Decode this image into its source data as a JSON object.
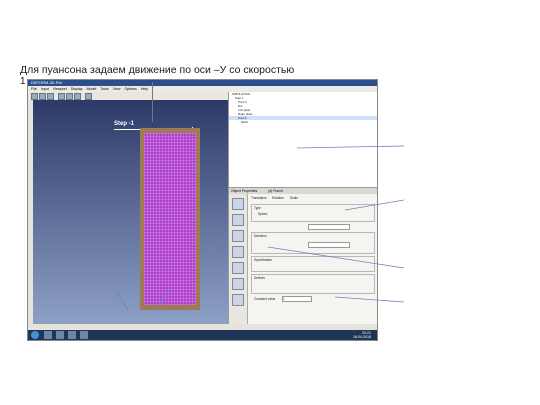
{
  "caption": {
    "line1": "Для пуансона задаем движение по оси –У  со скоростью",
    "line2": "1"
  },
  "app": {
    "title": "DEFORM-3D Pre",
    "menu": [
      "File",
      "Input",
      "Viewport",
      "Display",
      "Model",
      "Tools",
      "View",
      "Options",
      "Help"
    ]
  },
  "viewport": {
    "step_label": "Step -1"
  },
  "tree": {
    "items": [
      "SIMULATION",
      "Step 1",
      "Punch",
      "Die",
      "Left plate",
      "Right plate",
      "Punch",
      "Mesh"
    ]
  },
  "properties": {
    "header": "Object Properties",
    "object": "(4) Punch",
    "tabs": [
      "Translation",
      "Rotation",
      "Scale"
    ],
    "type_label": "Type",
    "speed_label": "Speed",
    "direction_label": "Direction",
    "specification_label": "Specification",
    "define_label": "Defines",
    "constant_value_label": "Constant value",
    "constant_value": "1"
  },
  "side_icons": [
    "General",
    "Geometry",
    "Mesh",
    "Movement",
    "Bdry. Cond.",
    "Properties",
    "Advanced"
  ],
  "taskbar": {
    "time": "20:21",
    "date": "18.04.2018"
  },
  "colors": {
    "mesh": "#b03fcf",
    "frame": "#a07a52",
    "viewport_top": "#2d3a68",
    "viewport_bottom": "#8da0c6",
    "taskbar": "#1f3557"
  }
}
